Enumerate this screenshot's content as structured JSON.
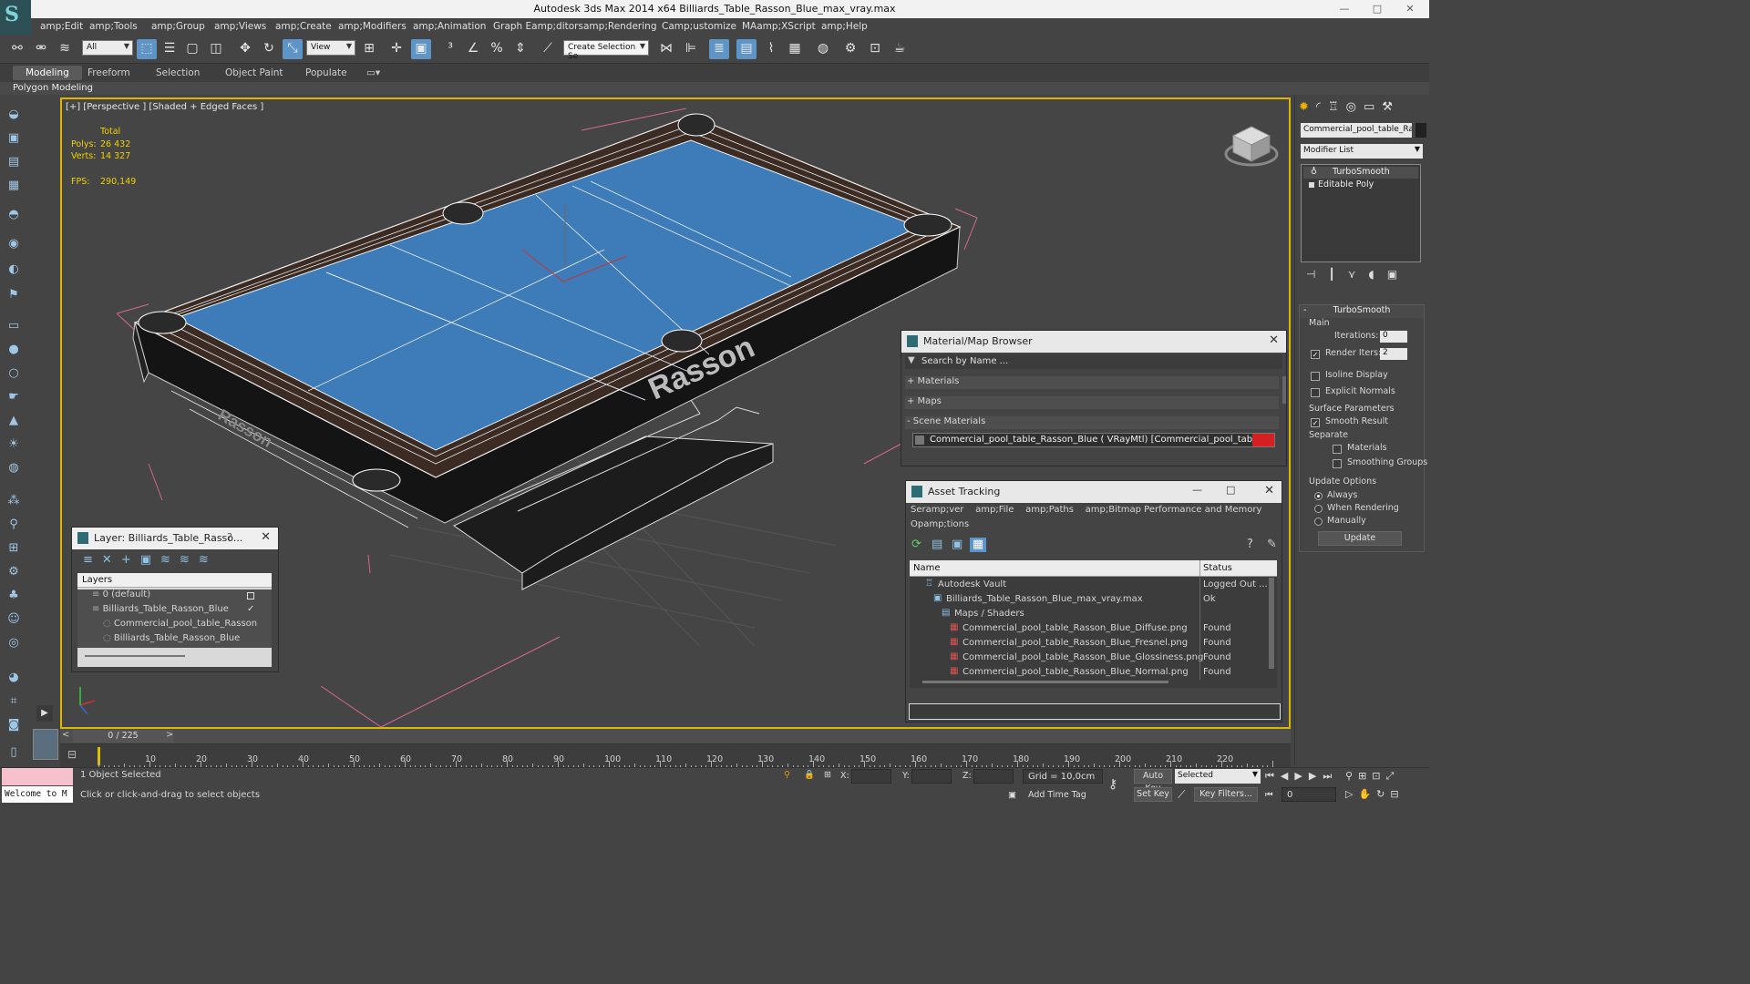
{
  "window": {
    "title": "Autodesk 3ds Max  2014 x64    Billiards_Table_Rasson_Blue_max_vray.max"
  },
  "menu": [
    "amp;Edit",
    "amp;Tools",
    "amp;Group",
    "amp;Views",
    "amp;Create",
    "amp;Modifiers",
    "amp;Animation",
    "Graph Eamp;ditors",
    "amp;Rendering",
    "Camp;ustomize",
    "MAamp;XScript",
    "amp;Help"
  ],
  "toolbar": {
    "selection_filter": "All",
    "ref_coord": "View",
    "named_selection": "Create Selection Se"
  },
  "ribbon": {
    "tabs": [
      "Modeling",
      "Freeform",
      "Selection",
      "Object Paint",
      "Populate"
    ],
    "active": "Modeling",
    "sub": "Polygon Modeling"
  },
  "viewport": {
    "label": "[+] [Perspective ] [Shaded + Edged Faces ]",
    "stats": {
      "total_label": "Total",
      "polys_label": "Polys:",
      "polys": "26 432",
      "verts_label": "Verts:",
      "verts": "14 327",
      "fps_label": "FPS:",
      "fps": "290,149"
    },
    "table_brand": "Rasson"
  },
  "layer_dialog": {
    "title": "Layer: Billiards_Table_Rasso...",
    "help": "?",
    "column": "Layers",
    "rows": [
      {
        "name": "0 (default)",
        "indent": 0
      },
      {
        "name": "Billiards_Table_Rasson_Blue",
        "indent": 0
      },
      {
        "name": "Commercial_pool_table_Rasson",
        "indent": 1
      },
      {
        "name": "Billiards_Table_Rasson_Blue",
        "indent": 1
      }
    ]
  },
  "mat_browser": {
    "title": "Material/Map Browser",
    "search_placeholder": "Search by Name ...",
    "sections": [
      "+ Materials",
      "+ Maps",
      "- Scene Materials"
    ],
    "scene_material": "Commercial_pool_table_Rasson_Blue ( VRayMtl) [Commercial_pool_table_Rasson]",
    "swatch_color": "#d42020"
  },
  "asset_tracking": {
    "title": "Asset Tracking",
    "menu1": [
      "Seramp;ver",
      "amp;File",
      "amp;Paths",
      "amp;Bitmap Performance and Memory"
    ],
    "menu2": "Opamp;tions",
    "columns": [
      "Name",
      "Status"
    ],
    "rows": [
      {
        "name": "Autodesk Vault",
        "status": "Logged Out ...",
        "indent": 1
      },
      {
        "name": "Billiards_Table_Rasson_Blue_max_vray.max",
        "status": "Ok",
        "indent": 2
      },
      {
        "name": "Maps / Shaders",
        "status": "",
        "indent": 3
      },
      {
        "name": "Commercial_pool_table_Rasson_Blue_Diffuse.png",
        "status": "Found",
        "indent": 4
      },
      {
        "name": "Commercial_pool_table_Rasson_Blue_Fresnel.png",
        "status": "Found",
        "indent": 4
      },
      {
        "name": "Commercial_pool_table_Rasson_Blue_Glossiness.png",
        "status": "Found",
        "indent": 4
      },
      {
        "name": "Commercial_pool_table_Rasson_Blue_Normal.png",
        "status": "Found",
        "indent": 4
      }
    ]
  },
  "command_panel": {
    "object_name": "Commercial_pool_table_Rasso",
    "modifier_list": "Modifier List",
    "stack": [
      "TurboSmooth",
      "Editable Poly"
    ],
    "rollout": "TurboSmooth",
    "main_label": "Main",
    "iterations_label": "Iterations:",
    "iterations": "0",
    "render_iters_label": "Render Iters:",
    "render_iters": "2",
    "isoline": "Isoline Display",
    "explicit_normals": "Explicit Normals",
    "surface_params": "Surface Parameters",
    "smooth_result": "Smooth Result",
    "separate": "Separate",
    "materials": "Materials",
    "smoothing_groups": "Smoothing Groups",
    "update_options": "Update Options",
    "always": "Always",
    "when_rendering": "When Rendering",
    "manually": "Manually",
    "update_btn": "Update"
  },
  "timeline": {
    "frame": "0 / 225",
    "ticks": [
      "10",
      "20",
      "30",
      "40",
      "50",
      "60",
      "70",
      "80",
      "90",
      "100",
      "110",
      "120",
      "130",
      "140",
      "150",
      "160",
      "170",
      "180",
      "190",
      "200",
      "210",
      "220"
    ]
  },
  "status": {
    "script_listener": "Welcome to M",
    "selected": "1 Object Selected",
    "prompt": "Click or click-and-drag to select objects",
    "x_label": "X:",
    "y_label": "Y:",
    "z_label": "Z:",
    "grid": "Grid = 10,0cm",
    "add_time_tag": "Add Time Tag",
    "auto_key": "Auto Key",
    "set_key": "Set Key",
    "selected_combo": "Selected",
    "key_filters": "Key Filters...",
    "frame_field": "0"
  },
  "colors": {
    "felt": "#3d7cb8",
    "accent": "#5d95c9",
    "viewport_border": "#e0b400",
    "stats": "#f0d000"
  }
}
